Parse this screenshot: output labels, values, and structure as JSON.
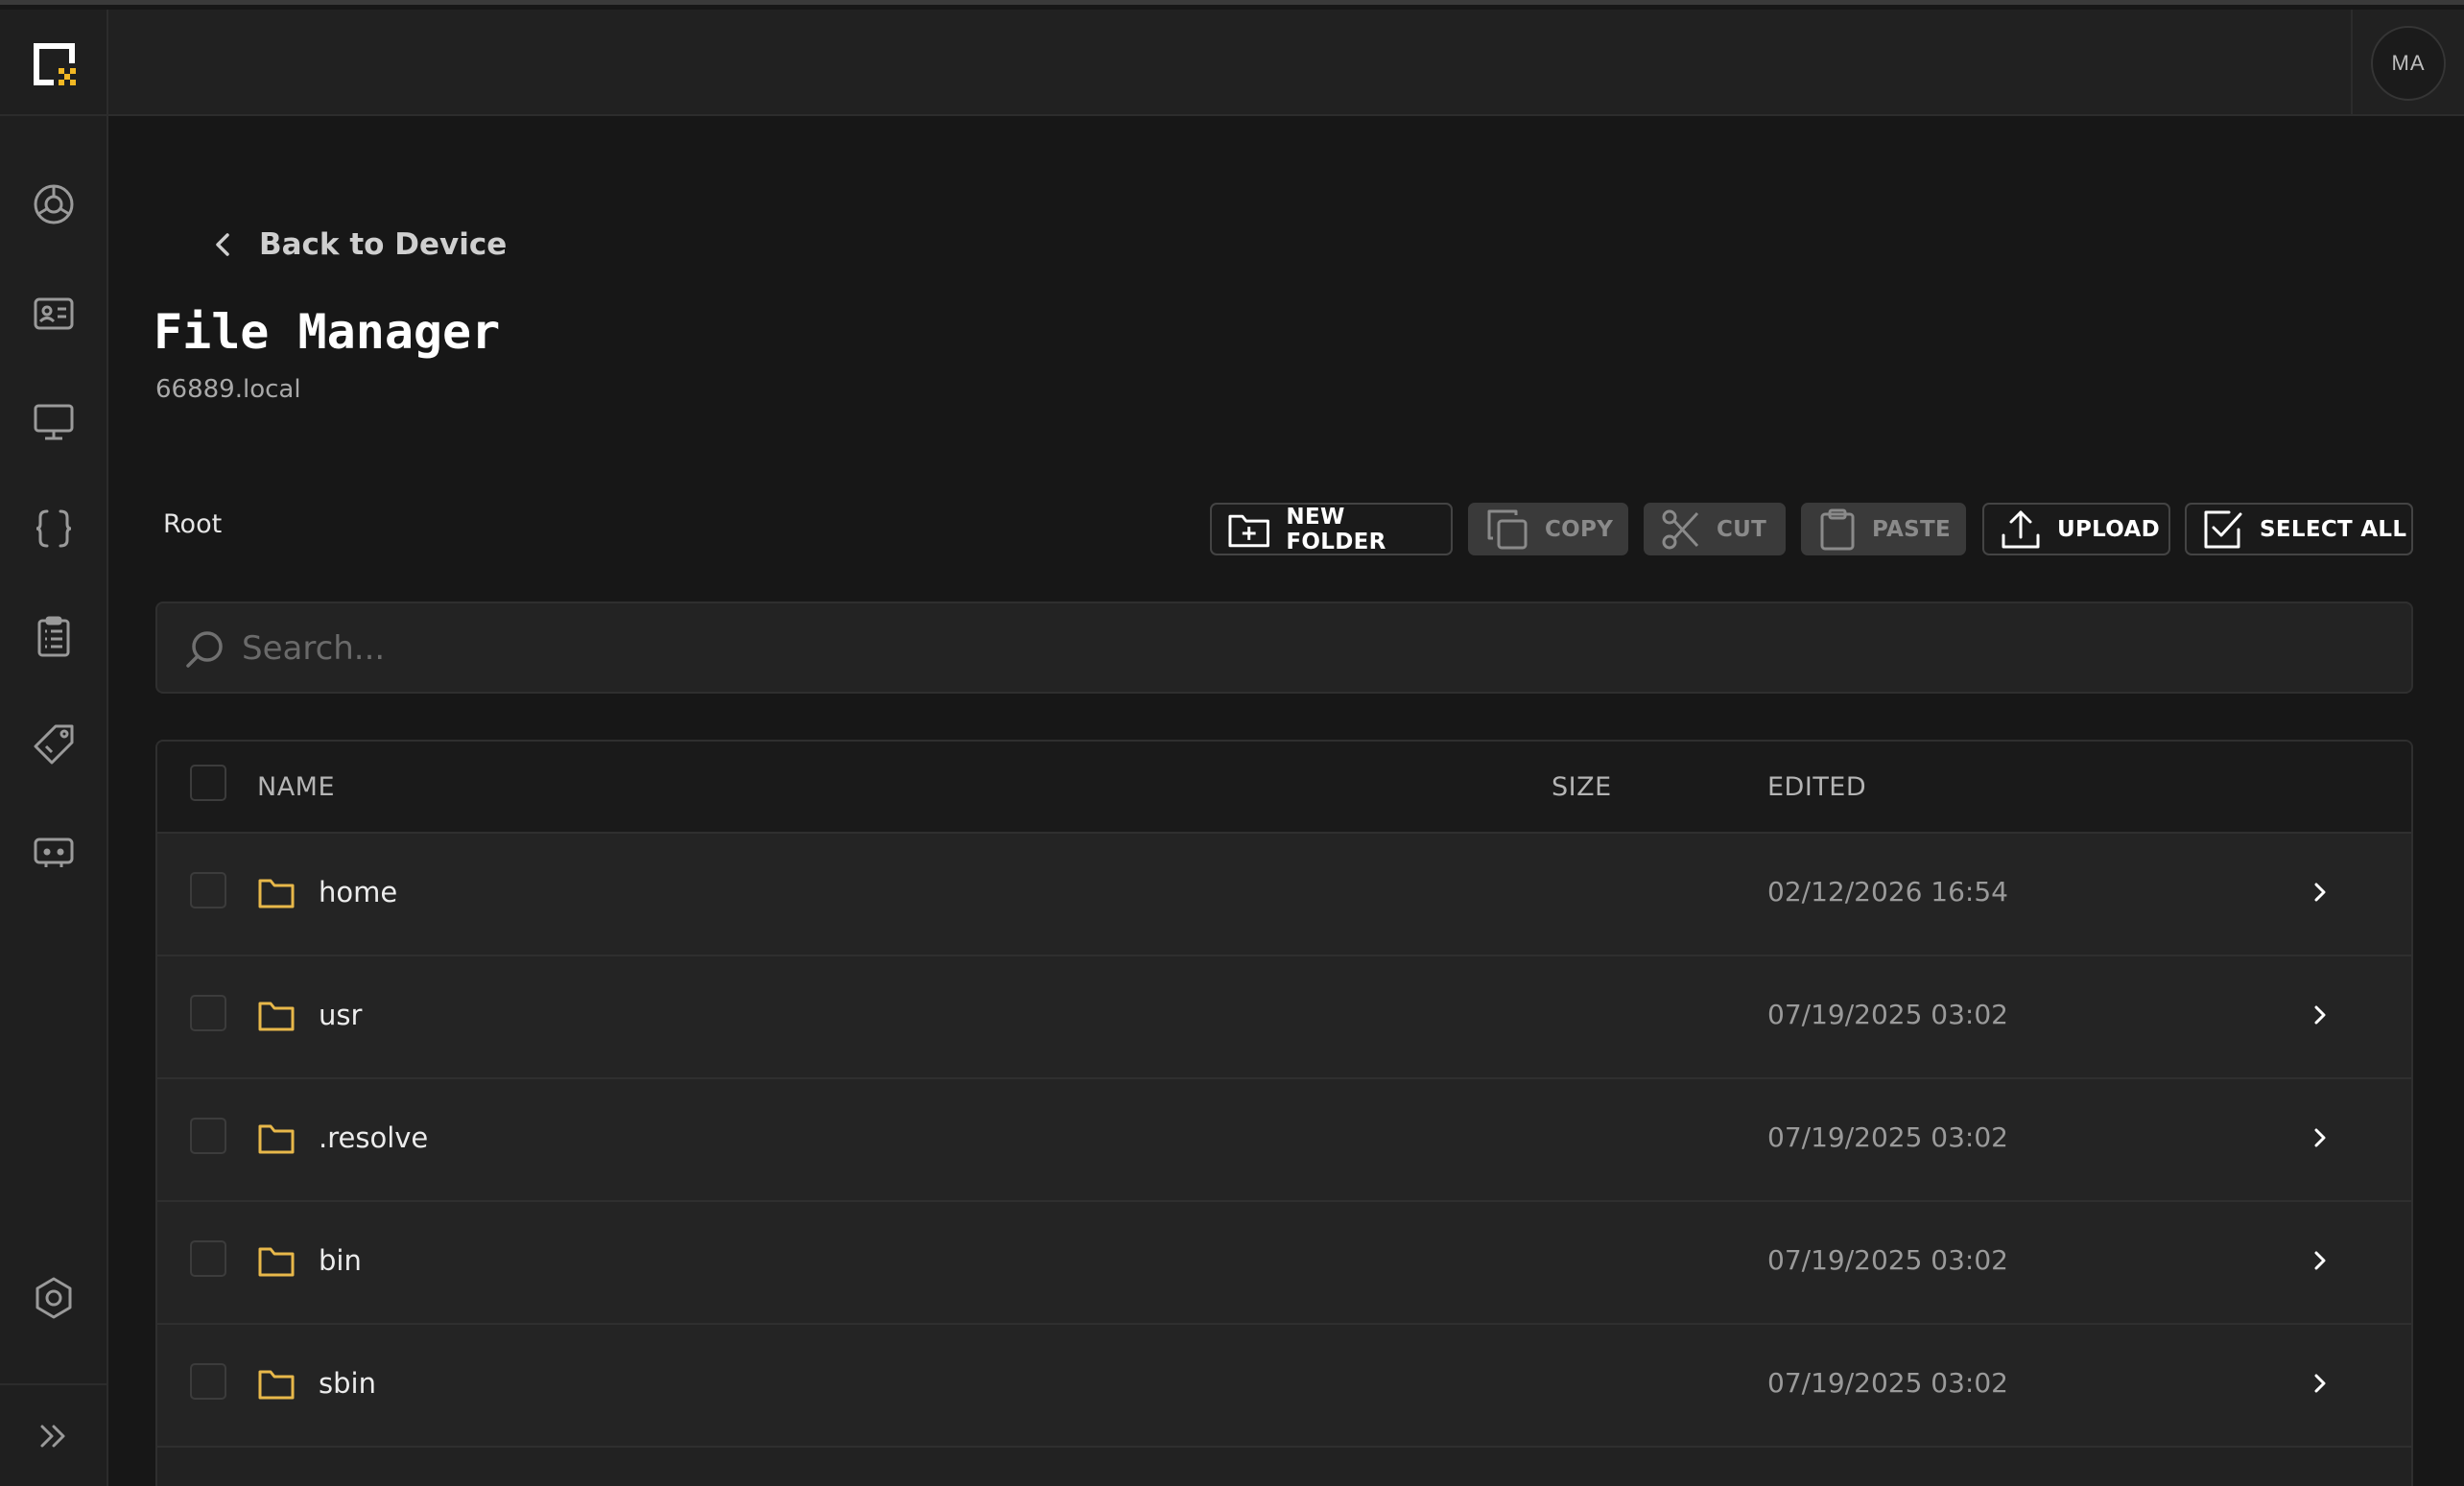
{
  "app": {
    "avatar_initials": "MA"
  },
  "nav": {
    "icons": [
      "dashboard-icon",
      "id-card-icon",
      "monitor-icon",
      "braces-icon",
      "clipboard-list-icon",
      "tag-icon",
      "gamepad-icon",
      "settings-icon"
    ],
    "expand_icon": "double-chevron-right-icon"
  },
  "header": {
    "back_label": "Back to Device",
    "title": "File Manager",
    "subtitle": "66889.local"
  },
  "breadcrumb": "Root",
  "toolbar": {
    "new_folder": "NEW FOLDER",
    "copy": "COPY",
    "cut": "CUT",
    "paste": "PASTE",
    "upload": "UPLOAD",
    "select_all": "SELECT ALL"
  },
  "search": {
    "placeholder": "Search..."
  },
  "table": {
    "columns": {
      "name": "NAME",
      "size": "SIZE",
      "edited": "EDITED"
    },
    "rows": [
      {
        "name": "home",
        "size": "",
        "edited": "02/12/2026 16:54"
      },
      {
        "name": "usr",
        "size": "",
        "edited": "07/19/2025 03:02"
      },
      {
        "name": ".resolve",
        "size": "",
        "edited": "07/19/2025 03:02"
      },
      {
        "name": "bin",
        "size": "",
        "edited": "07/19/2025 03:02"
      },
      {
        "name": "sbin",
        "size": "",
        "edited": "07/19/2025 03:02"
      }
    ]
  },
  "colors": {
    "background": "#171717",
    "panel": "#222222",
    "folder": "#e8b84a",
    "logo_accent": "#f2b824"
  }
}
